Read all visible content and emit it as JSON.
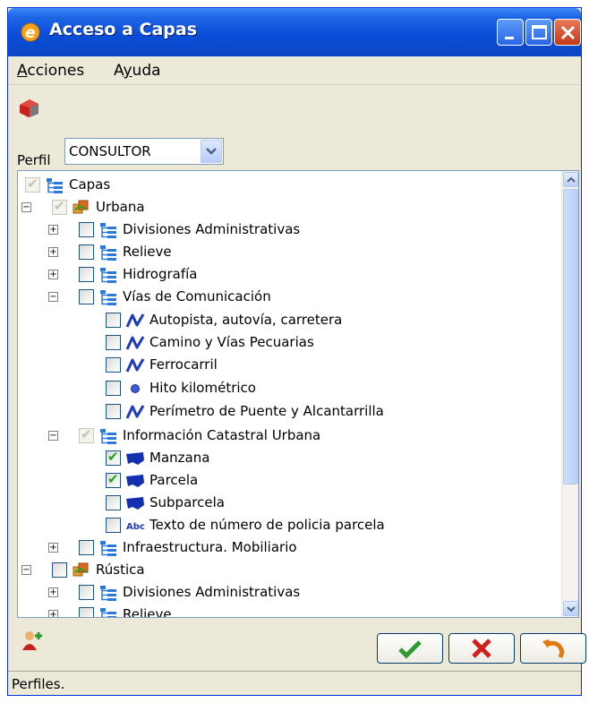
{
  "window": {
    "title": "Acceso a Capas",
    "colors": {
      "titlebar": "#0a4ed8",
      "check": "#21a121"
    }
  },
  "menu": [
    {
      "label_underlined": "A",
      "label_rest": "cciones"
    },
    {
      "label_pre": "A",
      "label_underlined": "y",
      "label_rest": "uda"
    }
  ],
  "perfil": {
    "label": "Perfil",
    "value": "CONSULTOR"
  },
  "tree": [
    {
      "label": "Capas",
      "icon": "layers-tree-icon",
      "checkbox": "disabled-checked",
      "expander": null
    },
    {
      "label": "Urbana",
      "icon": "layer-group-icon",
      "checkbox": "disabled-checked",
      "expander": "minus"
    },
    {
      "label": "Divisiones Administrativas",
      "icon": "layers-tree-icon",
      "checkbox": "unchecked",
      "expander": "plus"
    },
    {
      "label": "Relieve",
      "icon": "layers-tree-icon",
      "checkbox": "unchecked",
      "expander": "plus"
    },
    {
      "label": "Hidrografía",
      "icon": "layers-tree-icon",
      "checkbox": "unchecked",
      "expander": "plus"
    },
    {
      "label": "Vías de Comunicación",
      "icon": "layers-tree-icon",
      "checkbox": "unchecked",
      "expander": "minus"
    },
    {
      "label": "Autopista, autovía, carretera",
      "icon": "line-layer-icon",
      "checkbox": "unchecked",
      "expander": null
    },
    {
      "label": "Camino y Vías Pecuarias",
      "icon": "line-layer-icon",
      "checkbox": "unchecked",
      "expander": null
    },
    {
      "label": "Ferrocarril",
      "icon": "line-layer-icon",
      "checkbox": "unchecked",
      "expander": null
    },
    {
      "label": "Hito kilométrico",
      "icon": "point-layer-icon",
      "checkbox": "unchecked",
      "expander": null
    },
    {
      "label": "Perímetro de Puente y Alcantarrilla",
      "icon": "line-layer-icon",
      "checkbox": "unchecked",
      "expander": null
    },
    {
      "label": "Información Catastral Urbana",
      "icon": "layers-tree-icon",
      "checkbox": "disabled-checked",
      "expander": "minus"
    },
    {
      "label": "Manzana",
      "icon": "polygon-layer-icon",
      "checkbox": "checked",
      "expander": null
    },
    {
      "label": "Parcela",
      "icon": "polygon-layer-icon",
      "checkbox": "checked",
      "expander": null
    },
    {
      "label": "Subparcela",
      "icon": "polygon-layer-icon",
      "checkbox": "unchecked",
      "expander": null
    },
    {
      "label": "Texto de número de policia parcela",
      "icon": "text-layer-icon",
      "checkbox": "unchecked",
      "expander": null
    },
    {
      "label": "Infraestructura. Mobiliario",
      "icon": "layers-tree-icon",
      "checkbox": "unchecked",
      "expander": "plus"
    },
    {
      "label": "Rústica",
      "icon": "layer-group-icon",
      "checkbox": "unchecked",
      "expander": "minus"
    },
    {
      "label": "Divisiones Administrativas",
      "icon": "layers-tree-icon",
      "checkbox": "unchecked",
      "expander": "plus"
    },
    {
      "label": "Relieve",
      "icon": "layers-tree-icon",
      "checkbox": "unchecked",
      "expander": "plus"
    }
  ],
  "text_icon_glyph": "Abc",
  "status": "Perfiles."
}
